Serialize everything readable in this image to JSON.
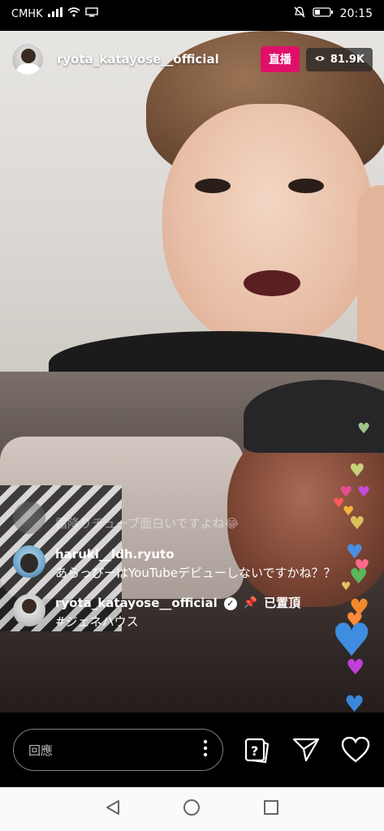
{
  "status_bar": {
    "carrier": "CMHK",
    "time": "20:15"
  },
  "header": {
    "host_username": "ryota_katayose__official",
    "live_label": "直播",
    "viewer_count": "81.9K"
  },
  "comments": [
    {
      "username": "",
      "text": "霜降りチューブ面白いですよね😂",
      "faded": true
    },
    {
      "username": "haruki__ldh.ryuto",
      "text": "あらっぴーはYouTubeデビューしないですかね？？"
    },
    {
      "username": "ryota_katayose__official",
      "verified": true,
      "pinned_label": "已置頂",
      "text": "#ジェネハウス"
    }
  ],
  "reply": {
    "placeholder": "回應"
  },
  "colors": {
    "live_badge": "#e00f6a",
    "background": "#000000"
  }
}
